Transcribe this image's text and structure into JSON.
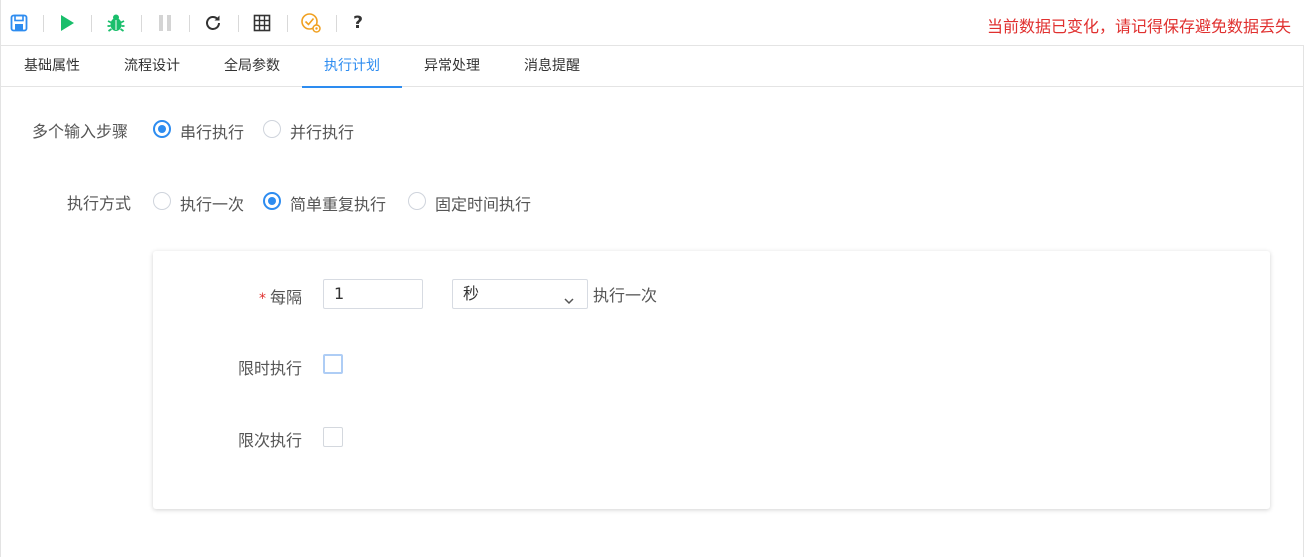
{
  "toolbar": {
    "buttons": [
      {
        "icon": "save-icon"
      },
      {
        "icon": "run-icon"
      },
      {
        "icon": "debug-icon"
      },
      {
        "icon": "pause-icon"
      },
      {
        "icon": "refresh-icon"
      },
      {
        "icon": "grid-icon"
      },
      {
        "icon": "schedule-check-icon"
      },
      {
        "icon": "help-icon",
        "glyph": "?"
      }
    ],
    "warning": "当前数据已变化，请记得保存避免数据丢失",
    "warning_color": "#e0302f"
  },
  "tabs": [
    {
      "label": "基础属性",
      "active": false
    },
    {
      "label": "流程设计",
      "active": false
    },
    {
      "label": "全局参数",
      "active": false
    },
    {
      "label": "执行计划",
      "active": true
    },
    {
      "label": "异常处理",
      "active": false
    },
    {
      "label": "消息提醒",
      "active": false
    }
  ],
  "accent_color": "#2d8cf0",
  "form": {
    "multi_input": {
      "label": "多个输入步骤",
      "options": [
        "串行执行",
        "并行执行"
      ],
      "selected": "串行执行"
    },
    "exec_mode": {
      "label": "执行方式",
      "options": [
        "执行一次",
        "简单重复执行",
        "固定时间执行"
      ],
      "selected": "简单重复执行"
    },
    "interval": {
      "required_mark": "*",
      "label": "每隔",
      "value": "1",
      "unit": "秒",
      "suffix": "执行一次"
    },
    "time_limit": {
      "label": "限时执行",
      "checked": false
    },
    "count_limit": {
      "label": "限次执行",
      "checked": false
    }
  }
}
